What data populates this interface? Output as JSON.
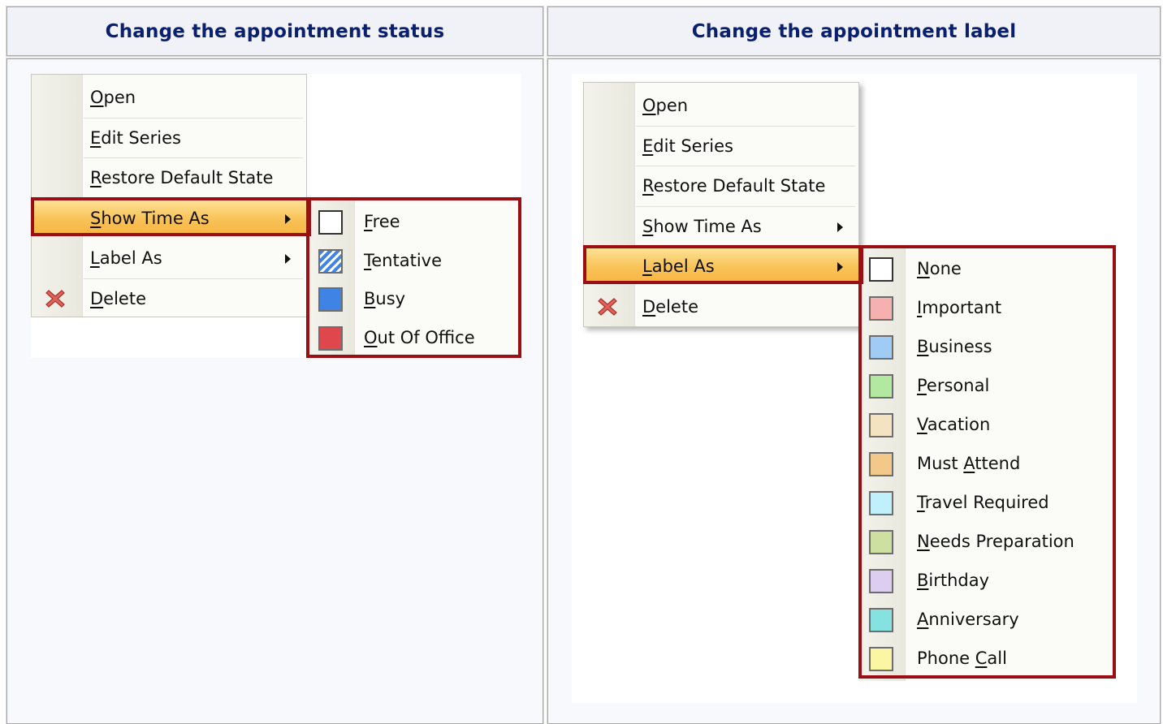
{
  "left_panel": {
    "header": "Change the appointment status",
    "menu": [
      {
        "label": "Open",
        "mnemonic": "O"
      },
      {
        "label": "Edit Series",
        "mnemonic": "E"
      },
      {
        "label": "Restore Default State",
        "mnemonic": "R"
      },
      {
        "label": "Show Time As",
        "mnemonic": "S",
        "submenu": true,
        "highlighted": true
      },
      {
        "label": "Label As",
        "mnemonic": "L",
        "submenu": true
      },
      {
        "label": "Delete",
        "mnemonic": "D",
        "icon": "delete-x-icon"
      }
    ],
    "submenu": [
      {
        "label": "Free",
        "mnemonic": "F",
        "color": "#ffffff"
      },
      {
        "label": "Tentative",
        "mnemonic": "T",
        "color": "#3f84e5",
        "pattern": "hatched"
      },
      {
        "label": "Busy",
        "mnemonic": "B",
        "color": "#3f84e5"
      },
      {
        "label": "Out Of Office",
        "mnemonic": "O",
        "color": "#e0474c"
      }
    ]
  },
  "right_panel": {
    "header": "Change the appointment label",
    "menu": [
      {
        "label": "Open",
        "mnemonic": "O"
      },
      {
        "label": "Edit Series",
        "mnemonic": "E"
      },
      {
        "label": "Restore Default State",
        "mnemonic": "R"
      },
      {
        "label": "Show Time As",
        "mnemonic": "S",
        "submenu": true
      },
      {
        "label": "Label As",
        "mnemonic": "L",
        "submenu": true,
        "highlighted": true
      },
      {
        "label": "Delete",
        "mnemonic": "D",
        "icon": "delete-x-icon"
      }
    ],
    "submenu": [
      {
        "label": "None",
        "mnemonic": "N",
        "color": "#ffffff"
      },
      {
        "label": "Important",
        "mnemonic": "I",
        "color": "#f6b0b0"
      },
      {
        "label": "Business",
        "mnemonic": "B",
        "color": "#9fcbf5"
      },
      {
        "label": "Personal",
        "mnemonic": "P",
        "color": "#b2e89f"
      },
      {
        "label": "Vacation",
        "mnemonic": "V",
        "color": "#f5e2c1"
      },
      {
        "label": "Must Attend",
        "mnemonic": "A",
        "color": "#f2c98a"
      },
      {
        "label": "Travel Required",
        "mnemonic": "T",
        "color": "#bff0fb"
      },
      {
        "label": "Needs Preparation",
        "mnemonic": "N",
        "color": "#cde0a2"
      },
      {
        "label": "Birthday",
        "mnemonic": "B",
        "color": "#ddcdf0"
      },
      {
        "label": "Anniversary",
        "mnemonic": "A",
        "color": "#86e1e1"
      },
      {
        "label": "Phone Call",
        "mnemonic": "C",
        "color": "#fbf6a3"
      }
    ]
  },
  "colors": {
    "header_text": "#0a1f6e",
    "highlight_border": "#9b0f14",
    "menu_hover": "#f9c45a"
  }
}
